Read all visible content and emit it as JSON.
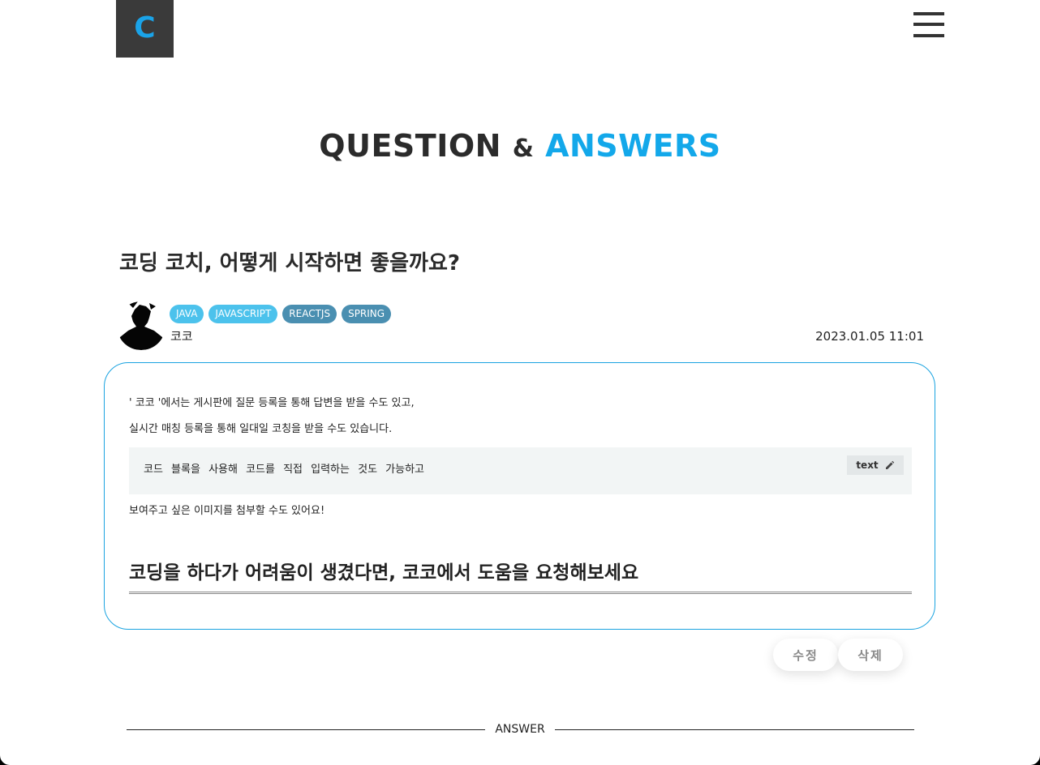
{
  "header": {
    "logo_letter": "C"
  },
  "banner": {
    "title_part1": "QUESTION",
    "title_amp": "&",
    "title_part2": "ANSWERS"
  },
  "question": {
    "title": "코딩 코치, 어떻게 시작하면 좋을까요?",
    "tags": [
      "JAVA",
      "JAVASCRIPT",
      "REACTJS",
      "SPRING"
    ],
    "author": "코코",
    "date": "2023.01.05 11:01"
  },
  "content": {
    "line1": "' 코코 '에서는 게시판에 질문 등록을 통해 답변을 받을 수도 있고,",
    "line2": "실시간 매칭 등록을 통해 일대일 코칭을 받을 수도 있습니다.",
    "code": "코드 블록을 사용해 코드를 직접 입력하는 것도 가능하고",
    "code_language": "text",
    "line3": "보여주고 싶은 이미지를 첨부할 수도 있어요!",
    "heading": "코딩을 하다가 어려움이 생겼다면, 코코에서 도움을 요청해보세요"
  },
  "actions": {
    "edit_label": "수정",
    "delete_label": "삭제"
  },
  "answer_section": {
    "label": "ANSWER"
  },
  "colors": {
    "accent": "#13a8ea",
    "tag_light": "#4cc2ec",
    "tag_dark": "#4a8fb1",
    "logo_bg": "#3a3a3a"
  },
  "icons": {
    "menu": "hamburger-menu-icon",
    "code_edit": "pencil-icon"
  }
}
